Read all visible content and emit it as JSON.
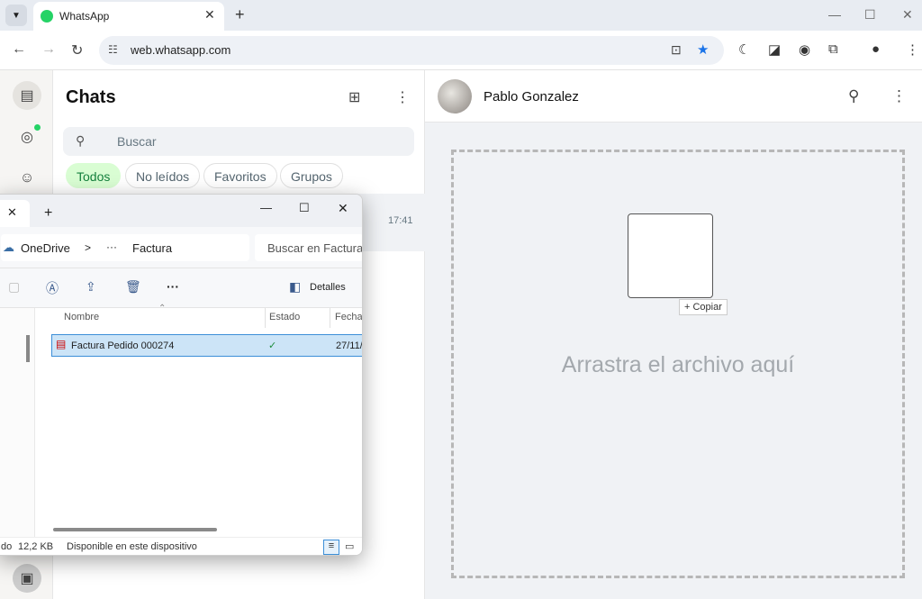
{
  "browser": {
    "tab_title": "WhatsApp",
    "tab_close": "✕",
    "new_tab": "+",
    "url": "web.whatsapp.com",
    "win_min": "—",
    "win_max": "☐",
    "win_close": "✕"
  },
  "whatsapp": {
    "chats_title": "Chats",
    "search_placeholder": "Buscar",
    "filters": [
      "Todos",
      "No leídos",
      "Favoritos",
      "Grupos"
    ],
    "chat_time": "17:41",
    "contact_name": "Pablo Gonzalez",
    "drop_text": "Arrastra el archivo aquí",
    "copy_badge": "+ Copiar",
    "accent": "#25d366"
  },
  "explorer": {
    "tab_close": "✕",
    "tab_add": "+",
    "btn_min": "—",
    "btn_max": "☐",
    "btn_close": "✕",
    "breadcrumb_root": "OneDrive",
    "breadcrumb_sep": ">",
    "breadcrumb_more": "···",
    "breadcrumb_folder": "Factura",
    "search_placeholder": "Buscar en Factura",
    "more_label": "···",
    "details_label": "Detalles",
    "columns": [
      "Nombre",
      "Estado",
      "Fecha"
    ],
    "file": {
      "name": "Factura Pedido 000274",
      "status_icon": "✓",
      "date": "27/11/"
    },
    "status_prefix": "do",
    "status_size": "12,2 KB",
    "status_text": "Disponible en este dispositivo"
  }
}
